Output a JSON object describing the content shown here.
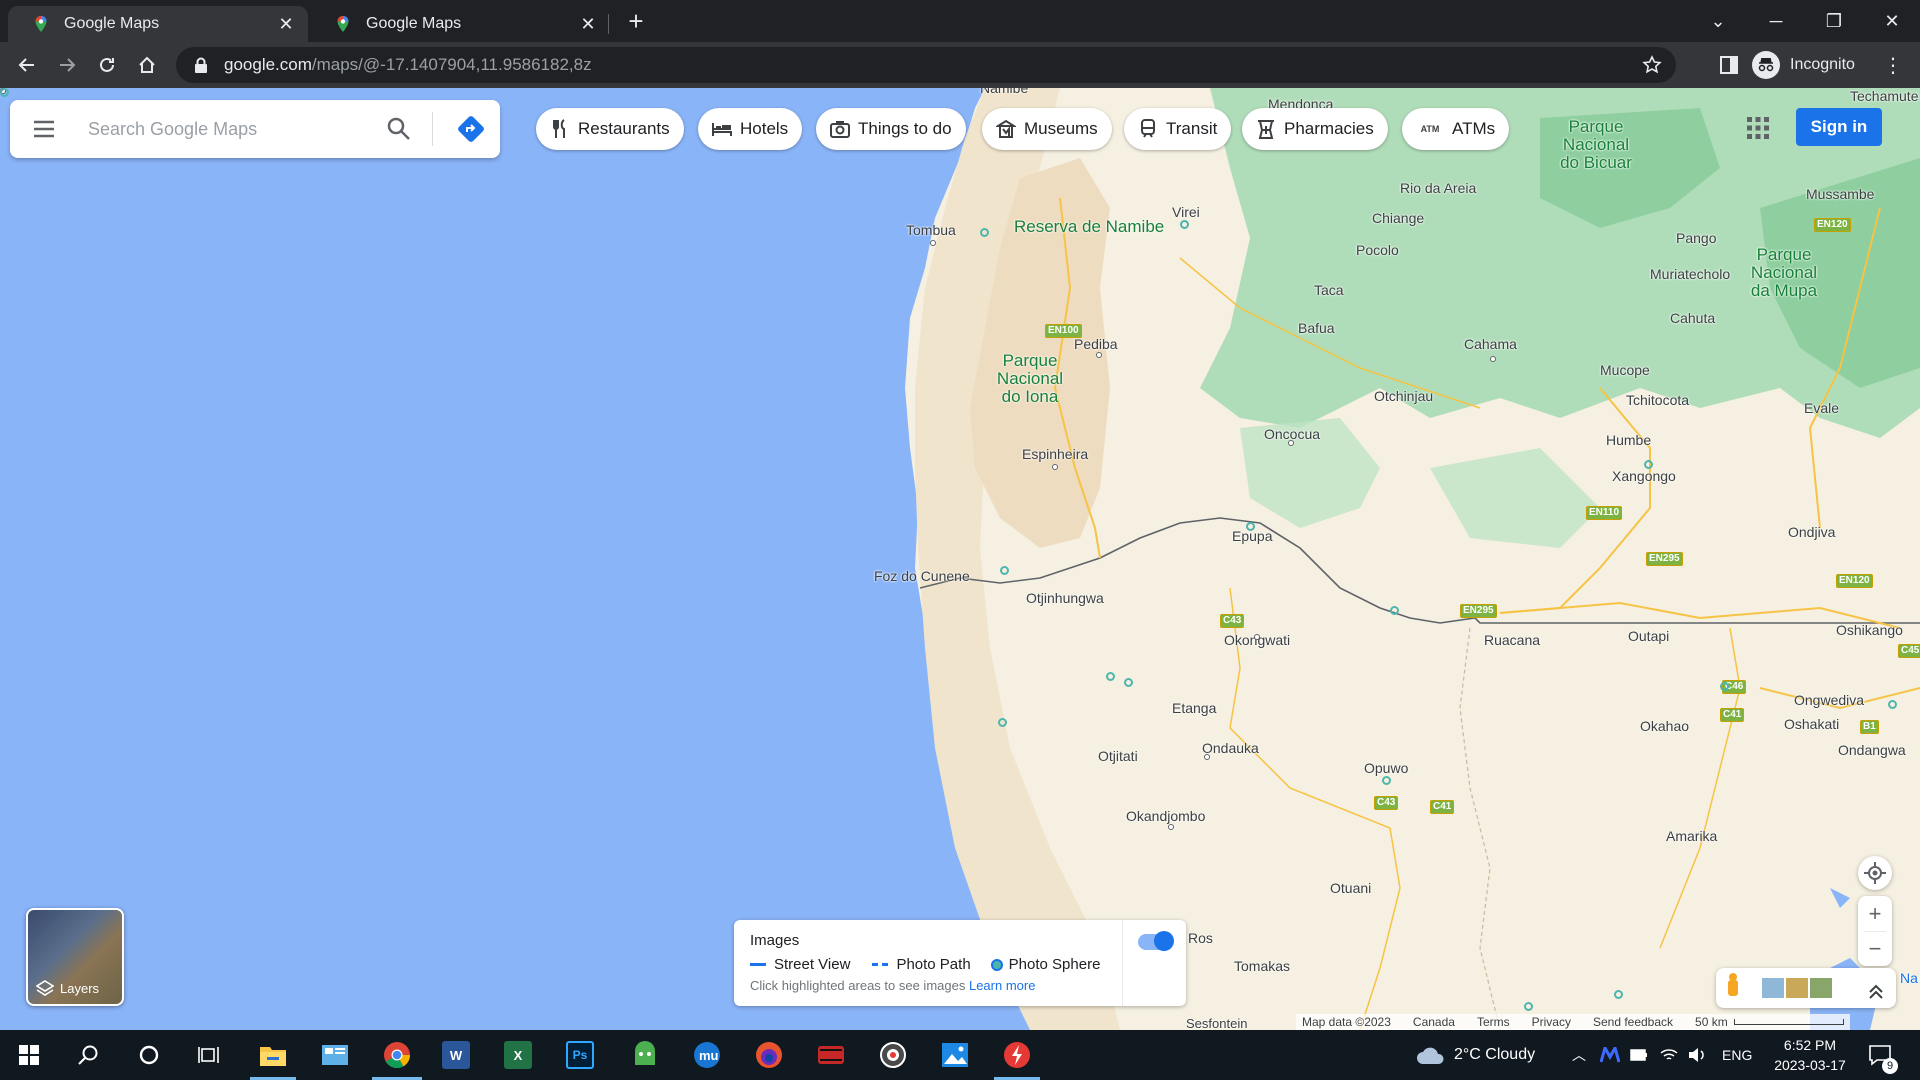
{
  "browser": {
    "tabs": [
      {
        "title": "Google Maps",
        "active": true
      },
      {
        "title": "Google Maps",
        "active": false
      }
    ],
    "url_host": "google.com",
    "url_path": "/maps/@-17.1407904,11.9586182,8z",
    "profile_label": "Incognito"
  },
  "search": {
    "placeholder": "Search Google Maps"
  },
  "chips": [
    {
      "label": "Restaurants",
      "icon": "fork-knife-icon"
    },
    {
      "label": "Hotels",
      "icon": "bed-icon"
    },
    {
      "label": "Things to do",
      "icon": "camera-icon"
    },
    {
      "label": "Museums",
      "icon": "museum-icon"
    },
    {
      "label": "Transit",
      "icon": "train-icon"
    },
    {
      "label": "Pharmacies",
      "icon": "pharmacy-icon"
    },
    {
      "label": "ATMs",
      "icon": "atm-icon"
    }
  ],
  "signin_label": "Sign in",
  "map": {
    "places": [
      "Namibe",
      "Mendonca",
      "Techamute",
      "Tombua",
      "Virei",
      "Rio da Areia",
      "Chiange",
      "Pocolo",
      "Mussambe",
      "Pango",
      "Muriatecholo",
      "Taca",
      "Bafua",
      "Cahuta",
      "Pediba",
      "Cahama",
      "Mucope",
      "Otchinjau",
      "Tchitocota",
      "Evale",
      "Oncocua",
      "Humbe",
      "Espinheira",
      "Xangongo",
      "Epupa",
      "Ondjiva",
      "Foz do Cunene",
      "Otjinhungwa",
      "Okongwati",
      "Ruacana",
      "Outapi",
      "Oshikango",
      "Ongwediva",
      "Oshakati",
      "Etanga",
      "Okahao",
      "Ondangwa",
      "Ondauka",
      "Otjitati",
      "Opuwo",
      "Okandjombo",
      "Amarika",
      "Otuani",
      "Tomakas",
      "Sesfontein"
    ],
    "parks": [
      "Reserva de Namibe",
      "Parque Nacional do Iona",
      "Parque Nacional do Bicuar",
      "Parque Nacional da Mupa"
    ],
    "roads": [
      "EN100",
      "EN120",
      "EN110",
      "EN295",
      "EN120",
      "C43",
      "EN295",
      "C45",
      "C46",
      "C41",
      "B1",
      "C43",
      "C41"
    ],
    "partial_labels": [
      "Ros",
      "Na"
    ]
  },
  "images_panel": {
    "title": "Images",
    "legend": [
      "Street View",
      "Photo Path",
      "Photo Sphere"
    ],
    "hint": "Click highlighted areas to see images",
    "link": "Learn more",
    "toggle_on": true
  },
  "layers_label": "Layers",
  "footer": {
    "attribution": "Map data ©2023",
    "region": "Canada",
    "terms": "Terms",
    "privacy": "Privacy",
    "feedback": "Send feedback",
    "scale": "50 km"
  },
  "taskbar": {
    "weather": "2°C  Cloudy",
    "lang": "ENG",
    "time": "6:52 PM",
    "date": "2023-03-17",
    "notifications": "9",
    "accent": "#76b9ed"
  }
}
